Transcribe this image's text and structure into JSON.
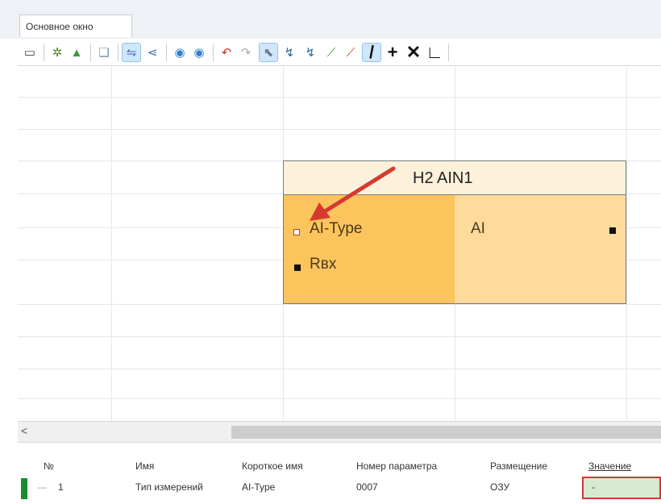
{
  "tab": {
    "label": "Основное окно"
  },
  "toolbar": {
    "items": [
      {
        "icon": "window-icon",
        "glyph": "▭"
      },
      {
        "icon": "gear-icon",
        "glyph": "✲"
      },
      {
        "icon": "upload-icon",
        "glyph": "▲"
      },
      {
        "icon": "document-icon",
        "glyph": "❏"
      },
      {
        "icon": "link-icon",
        "glyph": "⇋"
      },
      {
        "icon": "share-icon",
        "glyph": "⋖"
      },
      {
        "icon": "circle-left-icon",
        "glyph": "◉"
      },
      {
        "icon": "circle-right-icon",
        "glyph": "◉"
      },
      {
        "icon": "undo-icon",
        "glyph": "↶"
      },
      {
        "icon": "redo-icon",
        "glyph": "↷"
      },
      {
        "icon": "pointer-icon",
        "glyph": "⬉"
      },
      {
        "icon": "connect-icon",
        "glyph": "↯"
      },
      {
        "icon": "disconnect-icon",
        "glyph": "↯"
      },
      {
        "icon": "node-add-icon",
        "glyph": "⟋"
      },
      {
        "icon": "node-remove-icon",
        "glyph": "⟋"
      },
      {
        "icon": "line-icon",
        "glyph": "/"
      },
      {
        "icon": "plus-icon",
        "glyph": "+"
      },
      {
        "icon": "cross-icon",
        "glyph": "✕"
      },
      {
        "icon": "corner-icon",
        "glyph": "∟"
      }
    ]
  },
  "block": {
    "title": "H2 AIN1",
    "inputs": [
      "AI-Type",
      "Rвх"
    ],
    "outputs": [
      "AI"
    ]
  },
  "scroll": {
    "left_arrow": "<"
  },
  "table": {
    "headers": [
      "№",
      "Имя",
      "Короткое имя",
      "Номер параметра",
      "Размещение",
      "Значение"
    ],
    "rows": [
      {
        "num": "1",
        "name": "Тип измерений",
        "short": "AI-Type",
        "param": "0007",
        "place": "ОЗУ",
        "value": "-"
      }
    ],
    "tree_prefix": "—"
  },
  "colors": {
    "block_inputs": "#fcc45c",
    "block_outputs": "#fddb9b",
    "block_title": "#fdf1dc",
    "arrow": "#d63a2f",
    "highlight_border": "#d0383b",
    "row_marker": "#1a8a2e"
  }
}
